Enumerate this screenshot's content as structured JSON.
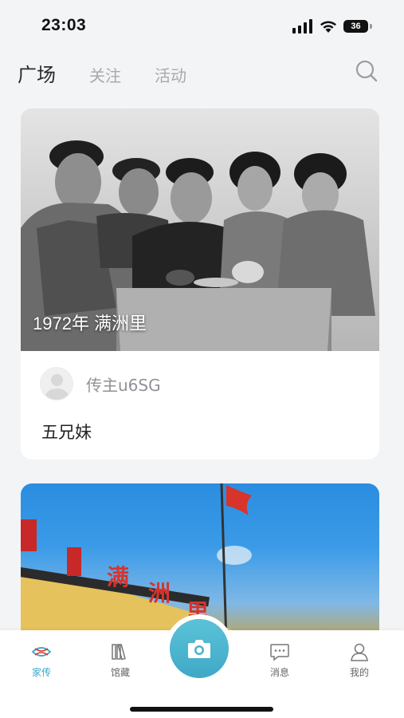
{
  "status_bar": {
    "time": "23:03",
    "battery": "36"
  },
  "top_tabs": [
    {
      "label": "广场",
      "active": true
    },
    {
      "label": "关注",
      "active": false
    },
    {
      "label": "活动",
      "active": false
    }
  ],
  "search": {
    "icon": "search-icon"
  },
  "feed": [
    {
      "photo_caption": "1972年 满洲里",
      "author": "传主u6SG",
      "title": "五兄妹"
    },
    {
      "photo_sign_text": [
        "满",
        "洲",
        "里"
      ]
    }
  ],
  "bottom_nav": [
    {
      "label": "家传",
      "icon": "eye-dna-icon",
      "active": true
    },
    {
      "label": "馆藏",
      "icon": "books-icon",
      "active": false
    },
    {
      "label": "",
      "icon": "camera-icon",
      "active": false
    },
    {
      "label": "消息",
      "icon": "message-icon",
      "active": false
    },
    {
      "label": "我的",
      "icon": "person-icon",
      "active": false
    }
  ],
  "colors": {
    "accent": "#3aa7c8",
    "background": "#f3f4f6"
  }
}
